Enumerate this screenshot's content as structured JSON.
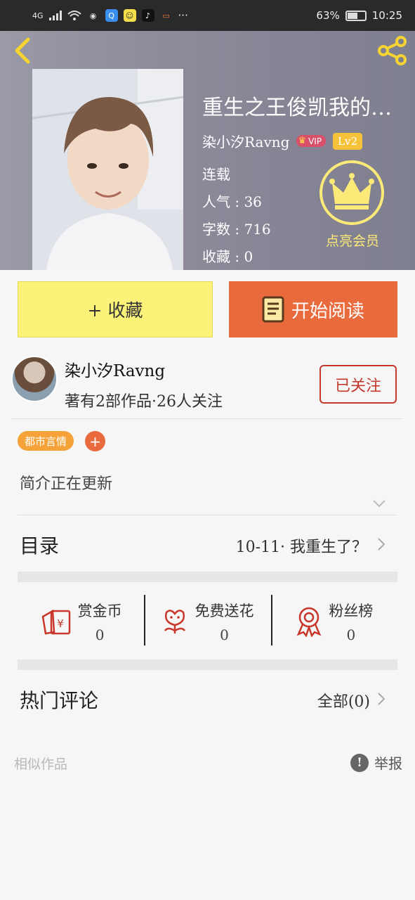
{
  "status_bar": {
    "network": "4G",
    "battery": "63%",
    "battery_level": 0.63,
    "time": "10:25",
    "more": "···"
  },
  "header": {
    "book_title": "重生之王俊凯我的…",
    "author": "染小汐Ravng",
    "vip_badge": "VIP",
    "level_badge": "Lv2",
    "status": "连载",
    "popularity": "人气 : 36",
    "word_count": "字数 : 716",
    "favorites": "收藏 : 0",
    "member_label": "点亮会员"
  },
  "actions": {
    "collect_label": "+ 收藏",
    "read_label": "开始阅读"
  },
  "author_card": {
    "name": "染小汐Ravng",
    "meta": "著有2部作品·26人关注",
    "follow_label": "已关注"
  },
  "tags": {
    "genre": "都市言情",
    "add": "+"
  },
  "intro": "简介正在更新",
  "toc": {
    "label": "目录",
    "latest": "10-11· 我重生了？"
  },
  "support": [
    {
      "label": "赏金币",
      "value": "0",
      "icon": "red-envelope-icon"
    },
    {
      "label": "免费送花",
      "value": "0",
      "icon": "flower-icon"
    },
    {
      "label": "粉丝榜",
      "value": "0",
      "icon": "medal-icon"
    }
  ],
  "comments": {
    "label": "热门评论",
    "all": "全部(0)"
  },
  "footer": {
    "similar": "相似作品",
    "report": "举报"
  },
  "colors": {
    "accent_orange": "#e86a3d",
    "collect_yellow": "#fbf27a",
    "follow_red": "#c4392b",
    "tag_orange": "#f5a338",
    "crown_yellow": "#fbe978"
  }
}
